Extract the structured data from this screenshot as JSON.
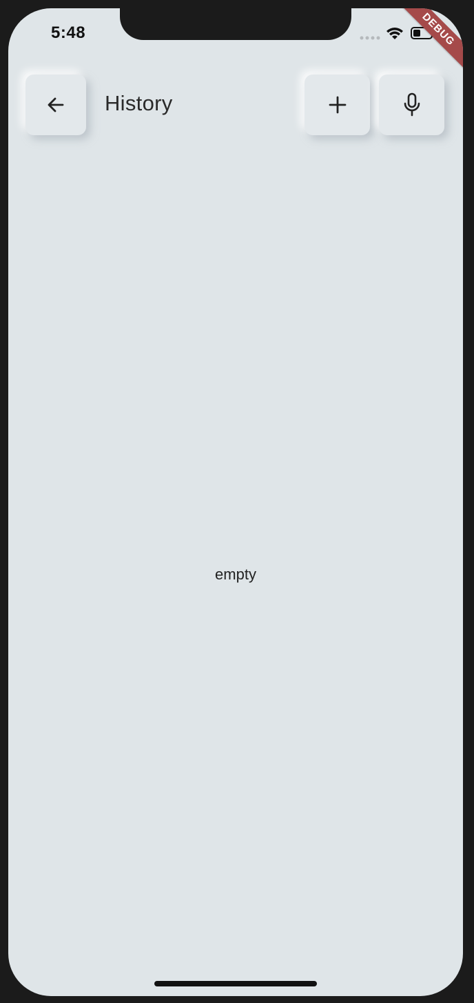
{
  "status_bar": {
    "time": "5:48"
  },
  "debug_banner": {
    "label": "DEBUG",
    "color": "#a54a4a"
  },
  "app_bar": {
    "title": "History",
    "back_icon": "arrow-left-icon",
    "add_icon": "plus-icon",
    "mic_icon": "microphone-icon"
  },
  "main": {
    "empty_text": "empty"
  },
  "colors": {
    "background": "#dfe5e8",
    "button": "#e3e8eb",
    "text": "#2a2a2a"
  }
}
